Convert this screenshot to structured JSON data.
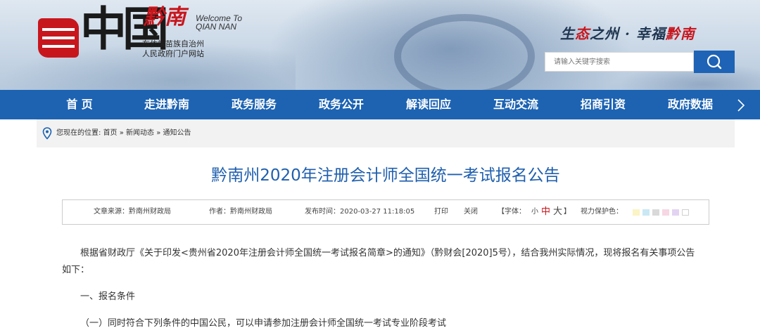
{
  "header": {
    "logo_zhongguo": "中国",
    "logo_qiannan": "黔南",
    "welcome_line1": "Welcome To",
    "welcome_line2": "QIAN NAN",
    "org_line1": "布依族苗族自治州",
    "org_line2": "人民政府门户网站",
    "slogan_part1": "生",
    "slogan_red1": "态",
    "slogan_part2": "之州 · 幸福",
    "slogan_red2": "黔南",
    "search_placeholder": "请输入关键字搜索"
  },
  "nav": {
    "items": [
      {
        "label": "首 页"
      },
      {
        "label": "走进黔南"
      },
      {
        "label": "政务服务"
      },
      {
        "label": "政务公开"
      },
      {
        "label": "解读回应"
      },
      {
        "label": "互动交流"
      },
      {
        "label": "招商引资"
      },
      {
        "label": "政府数据"
      }
    ]
  },
  "breadcrumb": {
    "prefix": "您现在的位置: ",
    "home": "首页",
    "sep": " » ",
    "news": "新闻动态",
    "current": "通知公告"
  },
  "article": {
    "title": "黔南州2020年注册会计师全国统一考试报名公告",
    "meta": {
      "source": "文章来源：黔南州财政局",
      "author": "作者：黔南州财政局",
      "time": "发布时间：2020-03-27 11:18:05",
      "print": "打印",
      "close": "关闭",
      "font_label": "【字体：",
      "font_small": "小",
      "font_medium": "中",
      "font_large": "大",
      "font_end": "】",
      "eye_label": "视力保护色：",
      "swatch_colors": [
        "#fbf4c4",
        "#c9e8f4",
        "#d9d9d9",
        "#f6d7e3",
        "#e3d3f2",
        "#ffffff"
      ]
    },
    "para1_line1": "根据省财政厅《关于印发<贵州省2020年注册会计师全国统一考试报名简章>的通知》（黔财会[2020]5号），结合我州实际情况，现将报名有关事项公告",
    "para1_line2": "如下：",
    "section1": "一、报名条件",
    "item1": "（一）同时符合下列条件的中国公民，可以申请参加注册会计师全国统一考试专业阶段考试"
  },
  "colors": {
    "nav_bg": "#1d63b2",
    "title_blue": "#1f5fae",
    "brand_red": "#c8161d",
    "search_btn": "#1e63b5"
  }
}
